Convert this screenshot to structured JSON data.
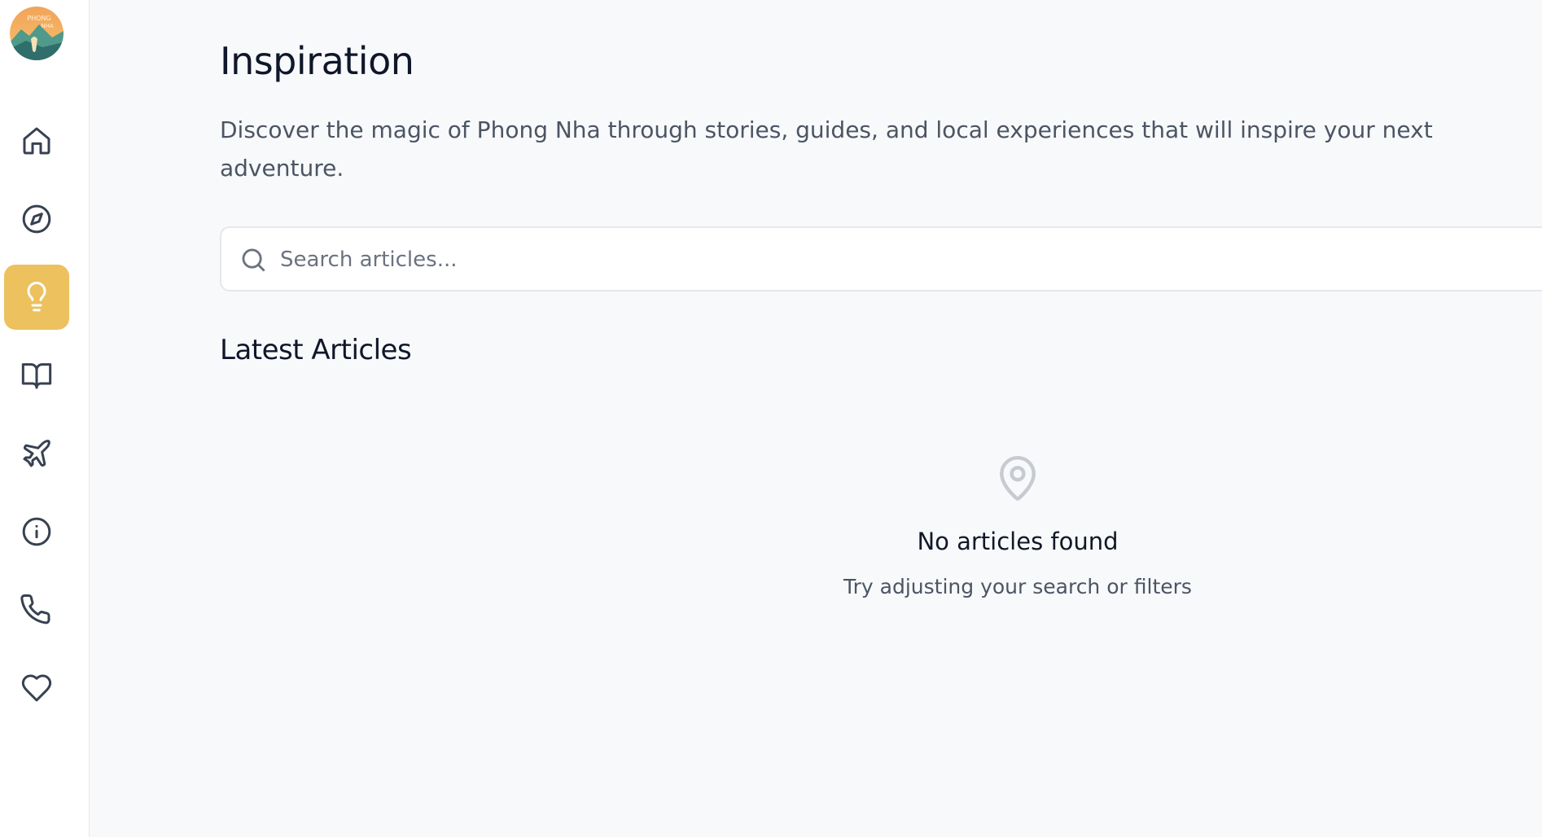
{
  "sidebar": {
    "logo_text": [
      "PHONG",
      "NHA"
    ],
    "items": [
      {
        "icon": "home-icon",
        "active": false
      },
      {
        "icon": "compass-icon",
        "active": false
      },
      {
        "icon": "lightbulb-icon",
        "active": true
      },
      {
        "icon": "book-open-icon",
        "active": false
      },
      {
        "icon": "plane-icon",
        "active": false
      },
      {
        "icon": "info-icon",
        "active": false
      },
      {
        "icon": "phone-icon",
        "active": false
      },
      {
        "icon": "heart-icon",
        "active": false
      }
    ],
    "active_color": "#ecc15e"
  },
  "main": {
    "title": "Inspiration",
    "description": "Discover the magic of Phong Nha through stories, guides, and local experiences that will inspire your next adventure.",
    "search": {
      "placeholder": "Search articles...",
      "value": ""
    },
    "section_title": "Latest Articles",
    "empty_state": {
      "icon": "map-pin-icon",
      "title": "No articles found",
      "subtitle": "Try adjusting your search or filters"
    }
  }
}
